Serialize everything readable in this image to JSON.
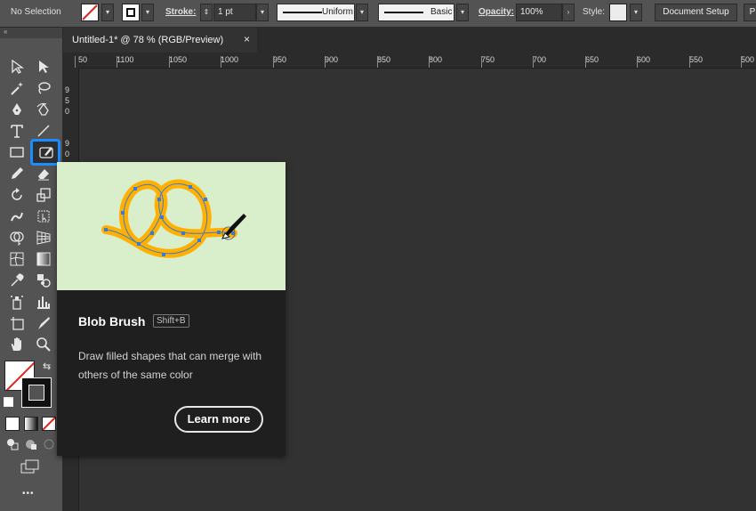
{
  "control_bar": {
    "selection": "No Selection",
    "stroke_label": "Stroke:",
    "stroke_weight": "1 pt",
    "stroke_profile": "Uniform",
    "brush": "Basic",
    "opacity_label": "Opacity:",
    "opacity_value": "100%",
    "style_label": "Style:",
    "document_setup": "Document Setup",
    "preferences_partial": "P"
  },
  "document_tab": {
    "title": "Untitled-1* @ 78 % (RGB/Preview)",
    "close": "×"
  },
  "toolbar": {
    "collapse": "«",
    "more": "•••"
  },
  "ruler": {
    "h_first_partial": "50",
    "h_labels": [
      "1100",
      "1050",
      "1000",
      "950",
      "900",
      "850",
      "800",
      "750",
      "700",
      "650",
      "600",
      "550",
      "500"
    ],
    "v_labels": [
      "9",
      "5",
      "0",
      "9",
      "0"
    ]
  },
  "tooltip": {
    "title": "Blob Brush",
    "shortcut": "Shift+B",
    "description": "Draw filled shapes that can merge with others of the same color",
    "learn_more": "Learn more"
  },
  "colors": {
    "accent": "#1c8dff",
    "pretzel": "#ffb000",
    "anchor": "#3a7bd5",
    "preview_bg": "#d9efcc"
  }
}
